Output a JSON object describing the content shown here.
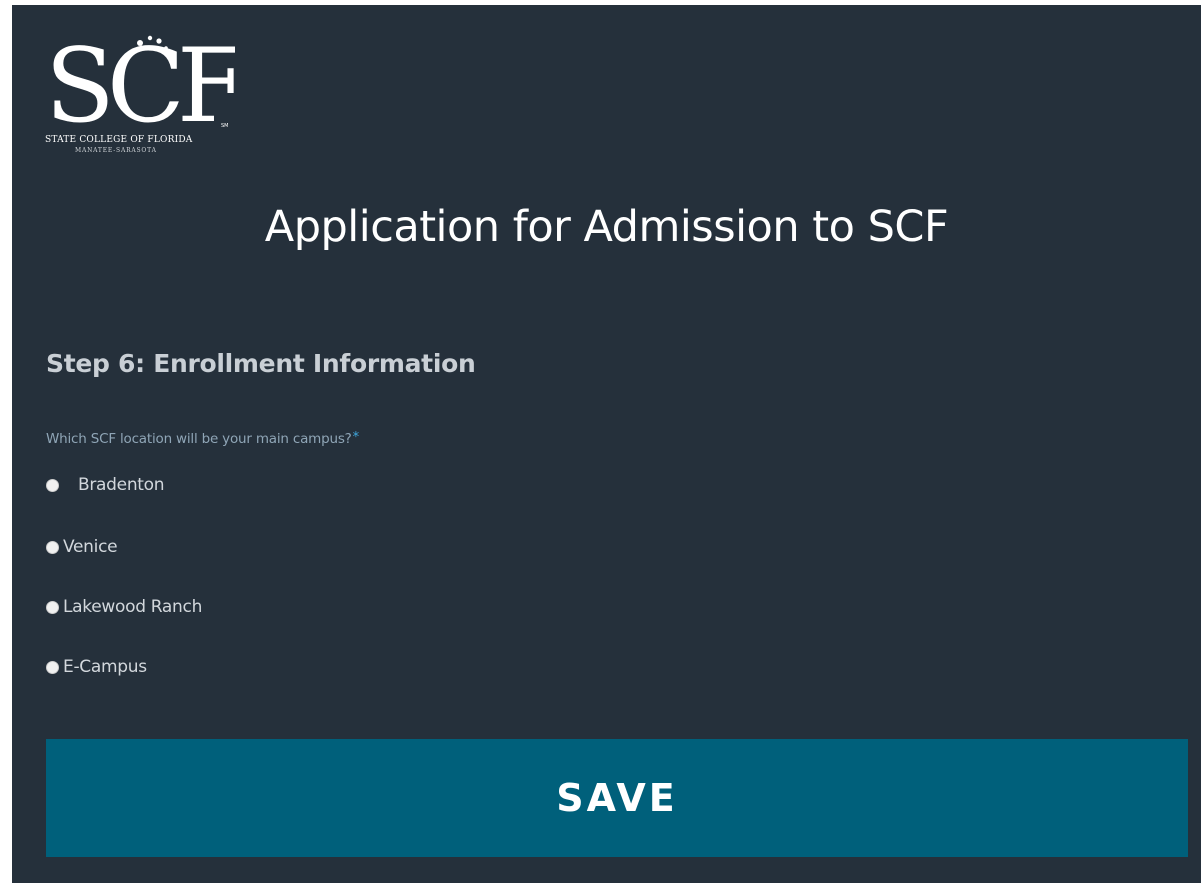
{
  "logo": {
    "mark_text": "SCF",
    "line1": "STATE COLLEGE OF FLORIDA",
    "line2": "MANATEE-SARASOTA",
    "trademark": "SM"
  },
  "header": {
    "title": "Application for Admission to SCF"
  },
  "form": {
    "step_heading": "Step 6: Enrollment Information",
    "question": "Which SCF location will be your main campus?",
    "required_marker": "*",
    "options": [
      {
        "label": "Bradenton",
        "selected": false
      },
      {
        "label": "Venice",
        "selected": false
      },
      {
        "label": "Lakewood Ranch",
        "selected": false
      },
      {
        "label": "E-Campus",
        "selected": false
      }
    ],
    "save_label": "SAVE"
  },
  "colors": {
    "background": "#25303b",
    "button": "#00607b",
    "required": "#3fa9e0"
  }
}
